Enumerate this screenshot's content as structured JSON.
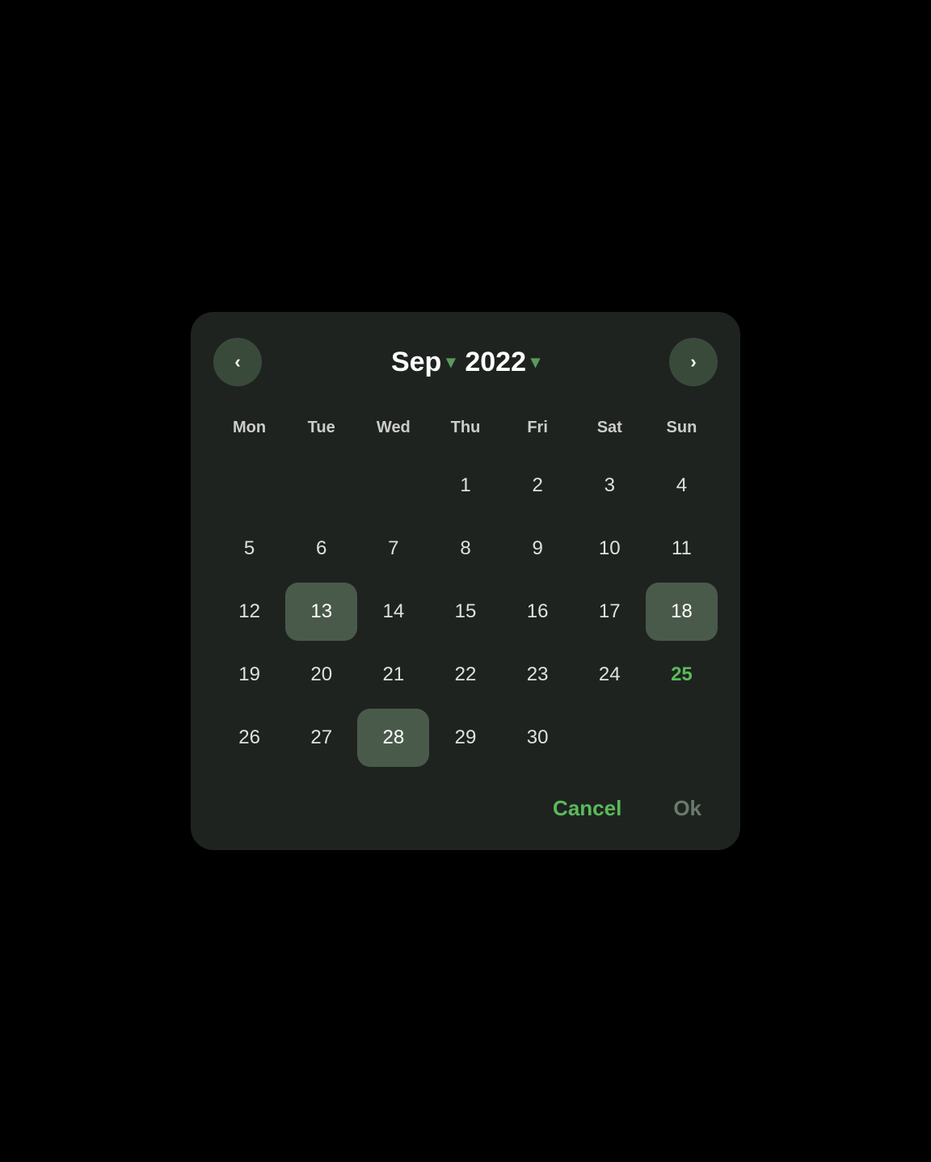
{
  "header": {
    "prev_label": "‹",
    "next_label": "›",
    "month_label": "Sep",
    "month_chevron": "▾",
    "year_label": "2022",
    "year_chevron": "▾"
  },
  "day_headers": [
    "Mon",
    "Tue",
    "Wed",
    "Thu",
    "Fri",
    "Sat",
    "Sun"
  ],
  "weeks": [
    [
      null,
      null,
      null,
      "1",
      "2",
      "3",
      "4"
    ],
    [
      "5",
      "6",
      "7",
      "8",
      "9",
      "10",
      "11"
    ],
    [
      "12",
      "13",
      "14",
      "15",
      "16",
      "17",
      "18"
    ],
    [
      "19",
      "20",
      "21",
      "22",
      "23",
      "24",
      "25"
    ],
    [
      "26",
      "27",
      "28",
      "29",
      "30",
      null,
      null
    ]
  ],
  "selected_dates": [
    "13",
    "18",
    "28"
  ],
  "highlighted_dates": [
    "25"
  ],
  "footer": {
    "cancel_label": "Cancel",
    "ok_label": "Ok"
  },
  "colors": {
    "selected_bg": "#4a5a4a",
    "accent": "#5aba5a",
    "nav_bg": "#3a4a3a",
    "dialog_bg": "#1e2320",
    "page_bg": "#000000"
  }
}
